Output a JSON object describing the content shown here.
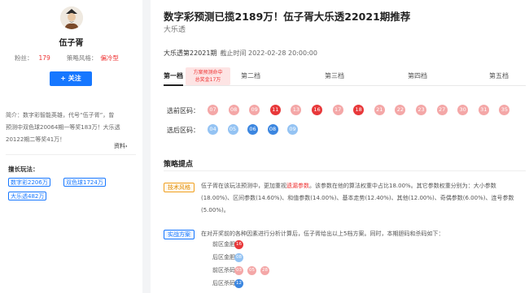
{
  "sidebar": {
    "author_name": "伍子胥",
    "fans_label": "粉丝：",
    "fans_value": "179",
    "style_label": "策略风格：",
    "style_value": "偏冷型",
    "follow_label": "+ 关注",
    "intro_lines": [
      "简介：数字彩智能英雄，代号“伍子胥”，曾",
      "预测中双色球20064期一等奖183万！大乐透",
      "20122期二等奖41万！"
    ],
    "more_label": "资料",
    "more_arrow": "›",
    "record_title": "擅长玩法：",
    "record_tags": [
      "数字彩2206万",
      "双色球1724万",
      "大乐透482万"
    ]
  },
  "main": {
    "headline": "数字彩预测已揽2189万！伍子胥大乐透22021期推荐",
    "subtitle": "大乐透",
    "period": "大乐透第22021期",
    "deadline": "截止时间 2022-02-28 20:00:00",
    "tabs": [
      "第一档",
      "第二档",
      "第三档",
      "第四档",
      "第五档"
    ],
    "tab_badge_line1": "方案预测命中",
    "tab_badge_line2": "总奖金17万",
    "front_label": "选前区码：",
    "front_numbers": [
      "07",
      "08",
      "09",
      "11",
      "13",
      "16",
      "17",
      "18",
      "21",
      "22",
      "23",
      "27",
      "30",
      "31",
      "35"
    ],
    "back_label": "选后区码：",
    "back_numbers": [
      "04",
      "05",
      "06",
      "08",
      "09"
    ],
    "section_title": "策略提点",
    "tech_badge": "技术风格",
    "tech_para_pre": "伍子胥在该玩法预测中，更加重视",
    "tech_para_hl": "遗漏参数",
    "tech_para_post": "。该参数在他的算法权重中占比18.00%。其它参数权重分别为：大小参数(18.00%)、区间参数(14.60%)、和值参数(14.00%)、基本走势(12.40%)、其他(12.00%)、奇偶参数(6.00%)、连号参数(5.00%)。",
    "plan_badge": "实战方案",
    "plan_para": "在对开奖前的各种因素进行分析计算后，伍子胥给出以上5档方案。同时，本期胆码和杀码如下：",
    "front_dan_label": "前区金胆：",
    "front_dan": [
      "16"
    ],
    "back_dan_label": "后区金胆：",
    "back_dan": [
      "08"
    ],
    "front_kill_label": "前区杀码：",
    "front_kill": [
      "03",
      "05",
      "28"
    ],
    "back_kill_label": "后区杀码：",
    "back_kill": [
      "12"
    ]
  },
  "colors": {
    "accent": "#1677ff",
    "red": "#e8383a",
    "red_light": "#f4a7a7",
    "blue": "#3b86e0",
    "blue_light": "#94c3f3"
  }
}
